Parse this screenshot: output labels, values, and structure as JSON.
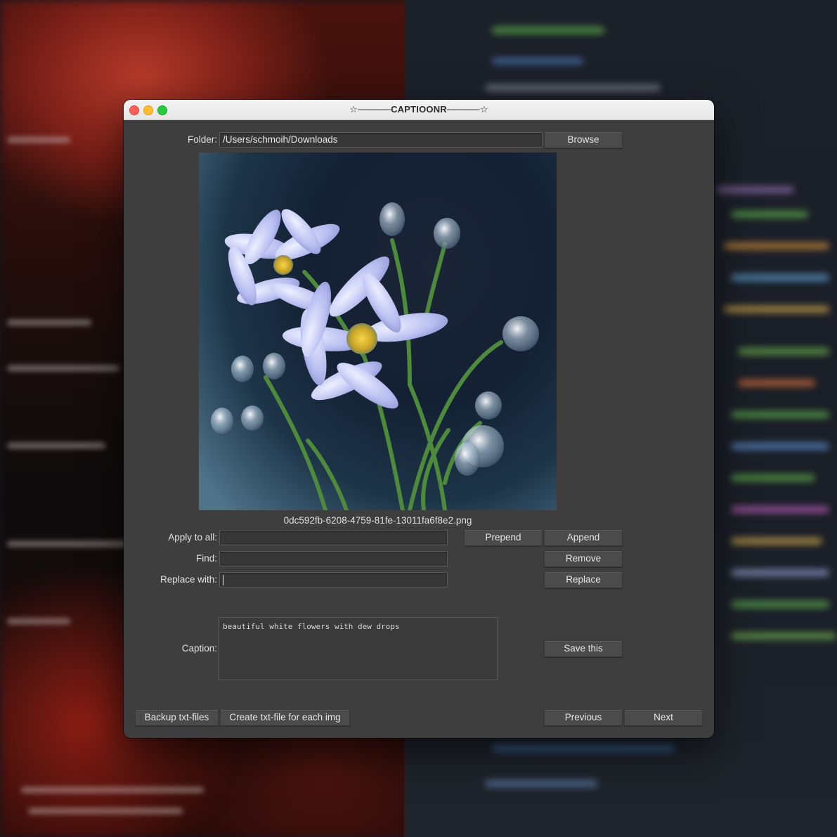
{
  "window": {
    "title": "☆─────CAPTIOONR─────☆"
  },
  "folder": {
    "label": "Folder:",
    "value": "/Users/schmoih/Downloads",
    "browse_label": "Browse"
  },
  "image": {
    "filename": "0dc592fb-6208-4759-81fe-13011fa6f8e2.png",
    "description_icon": "flower-image"
  },
  "apply_to_all": {
    "label": "Apply to all:",
    "value": "",
    "prepend_label": "Prepend",
    "append_label": "Append"
  },
  "find": {
    "label": "Find:",
    "value": "",
    "remove_label": "Remove"
  },
  "replace": {
    "label": "Replace with:",
    "value": "",
    "replace_label": "Replace"
  },
  "caption": {
    "label": "Caption:",
    "value": "beautiful white flowers with dew drops",
    "save_label": "Save this"
  },
  "footer": {
    "backup_label": "Backup txt-files",
    "create_label": "Create txt-file for each img",
    "previous_label": "Previous",
    "next_label": "Next"
  },
  "colors": {
    "window_bg": "#3e3e3e",
    "titlebar_bg": "#e9e9e9",
    "close": "#fe5f57",
    "minimize": "#febc2e",
    "maximize": "#28c840"
  }
}
